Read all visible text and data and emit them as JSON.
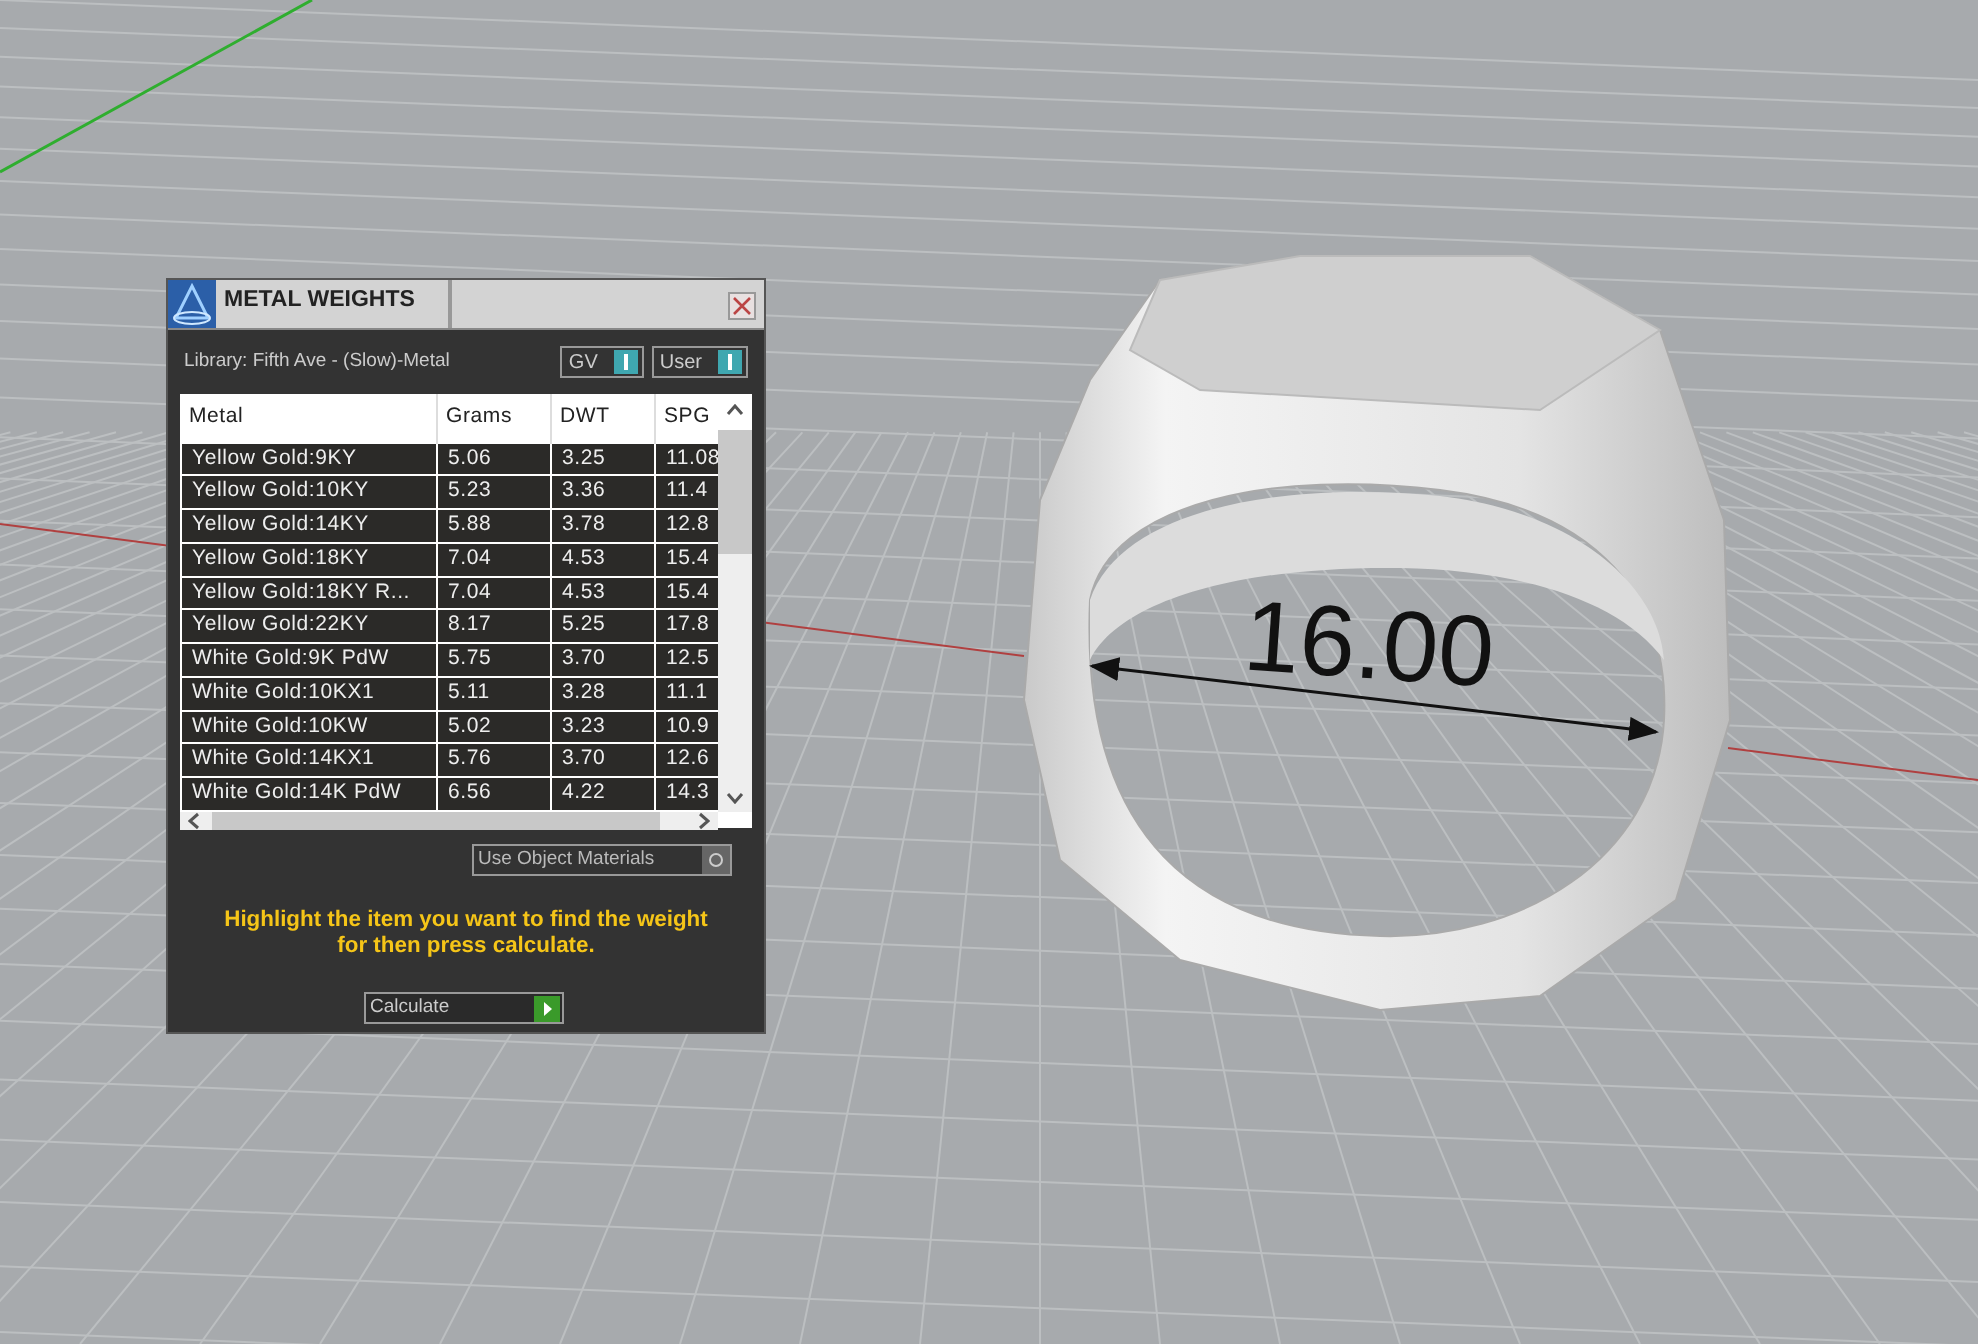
{
  "viewport": {
    "dimension_label": "16.00"
  },
  "panel": {
    "title": "METAL WEIGHTS",
    "library": "Library: Fifth Ave - (Slow)-Metal",
    "toggles": [
      {
        "label": "GV",
        "on": true
      },
      {
        "label": "User",
        "on": true
      }
    ],
    "table": {
      "columns": [
        "Metal",
        "Grams",
        "DWT",
        "SPG"
      ],
      "rows": [
        [
          "Yellow Gold:9KY",
          "5.06",
          "3.25",
          "11.08"
        ],
        [
          "Yellow Gold:10KY",
          "5.23",
          "3.36",
          "11.4"
        ],
        [
          "Yellow Gold:14KY",
          "5.88",
          "3.78",
          "12.8"
        ],
        [
          "Yellow Gold:18KY",
          "7.04",
          "4.53",
          "15.4"
        ],
        [
          "Yellow Gold:18KY R...",
          "7.04",
          "4.53",
          "15.4"
        ],
        [
          "Yellow Gold:22KY",
          "8.17",
          "5.25",
          "17.8"
        ],
        [
          "White Gold:9K PdW",
          "5.75",
          "3.70",
          "12.5"
        ],
        [
          "White Gold:10KX1",
          "5.11",
          "3.28",
          "11.1"
        ],
        [
          "White Gold:10KW",
          "5.02",
          "3.23",
          "10.9"
        ],
        [
          "White Gold:14KX1",
          "5.76",
          "3.70",
          "12.6"
        ],
        [
          "White Gold:14K PdW",
          "6.56",
          "4.22",
          "14.3"
        ]
      ]
    },
    "material_toggle": {
      "label": "Use Object Materials",
      "on": false
    },
    "hint": "Highlight the item you want to find the weight for then press calculate.",
    "calculate_button": "Calculate"
  }
}
